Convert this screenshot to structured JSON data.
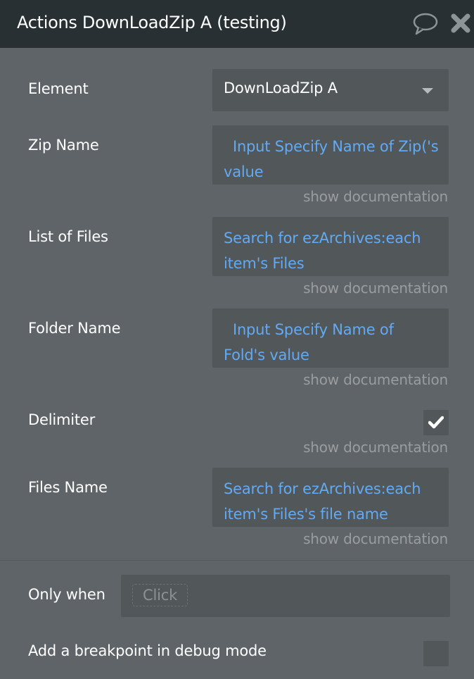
{
  "header": {
    "title": "Actions DownLoadZip A (testing)",
    "icons": [
      "comment-icon",
      "close-icon"
    ]
  },
  "fields": {
    "element": {
      "label": "Element",
      "value": "DownLoadZip A"
    },
    "zip_name": {
      "label": "Zip Name",
      "value": "  Input Specify Name of Zip('s value",
      "doc": "show documentation"
    },
    "list_of_files": {
      "label": "List of Files",
      "value": "Search for ezArchives:each item's Files",
      "doc": "show documentation"
    },
    "folder_name": {
      "label": "Folder Name",
      "value": "  Input Specify Name of Fold's value",
      "doc": "show documentation"
    },
    "delimiter": {
      "label": "Delimiter",
      "checked": true,
      "doc": "show documentation"
    },
    "files_name": {
      "label": "Files Name",
      "value": "Search for ezArchives:each item's Files's file name",
      "doc": "show documentation"
    }
  },
  "condition": {
    "label": "Only when",
    "placeholder": "Click"
  },
  "breakpoint": {
    "label": "Add a breakpoint in debug mode",
    "checked": false
  },
  "colors": {
    "header_bg": "#293033",
    "panel_bg": "#5f6468",
    "field_bg": "#52575a",
    "expression_text": "#63aaf2",
    "doc_text": "#9a9d9f"
  }
}
